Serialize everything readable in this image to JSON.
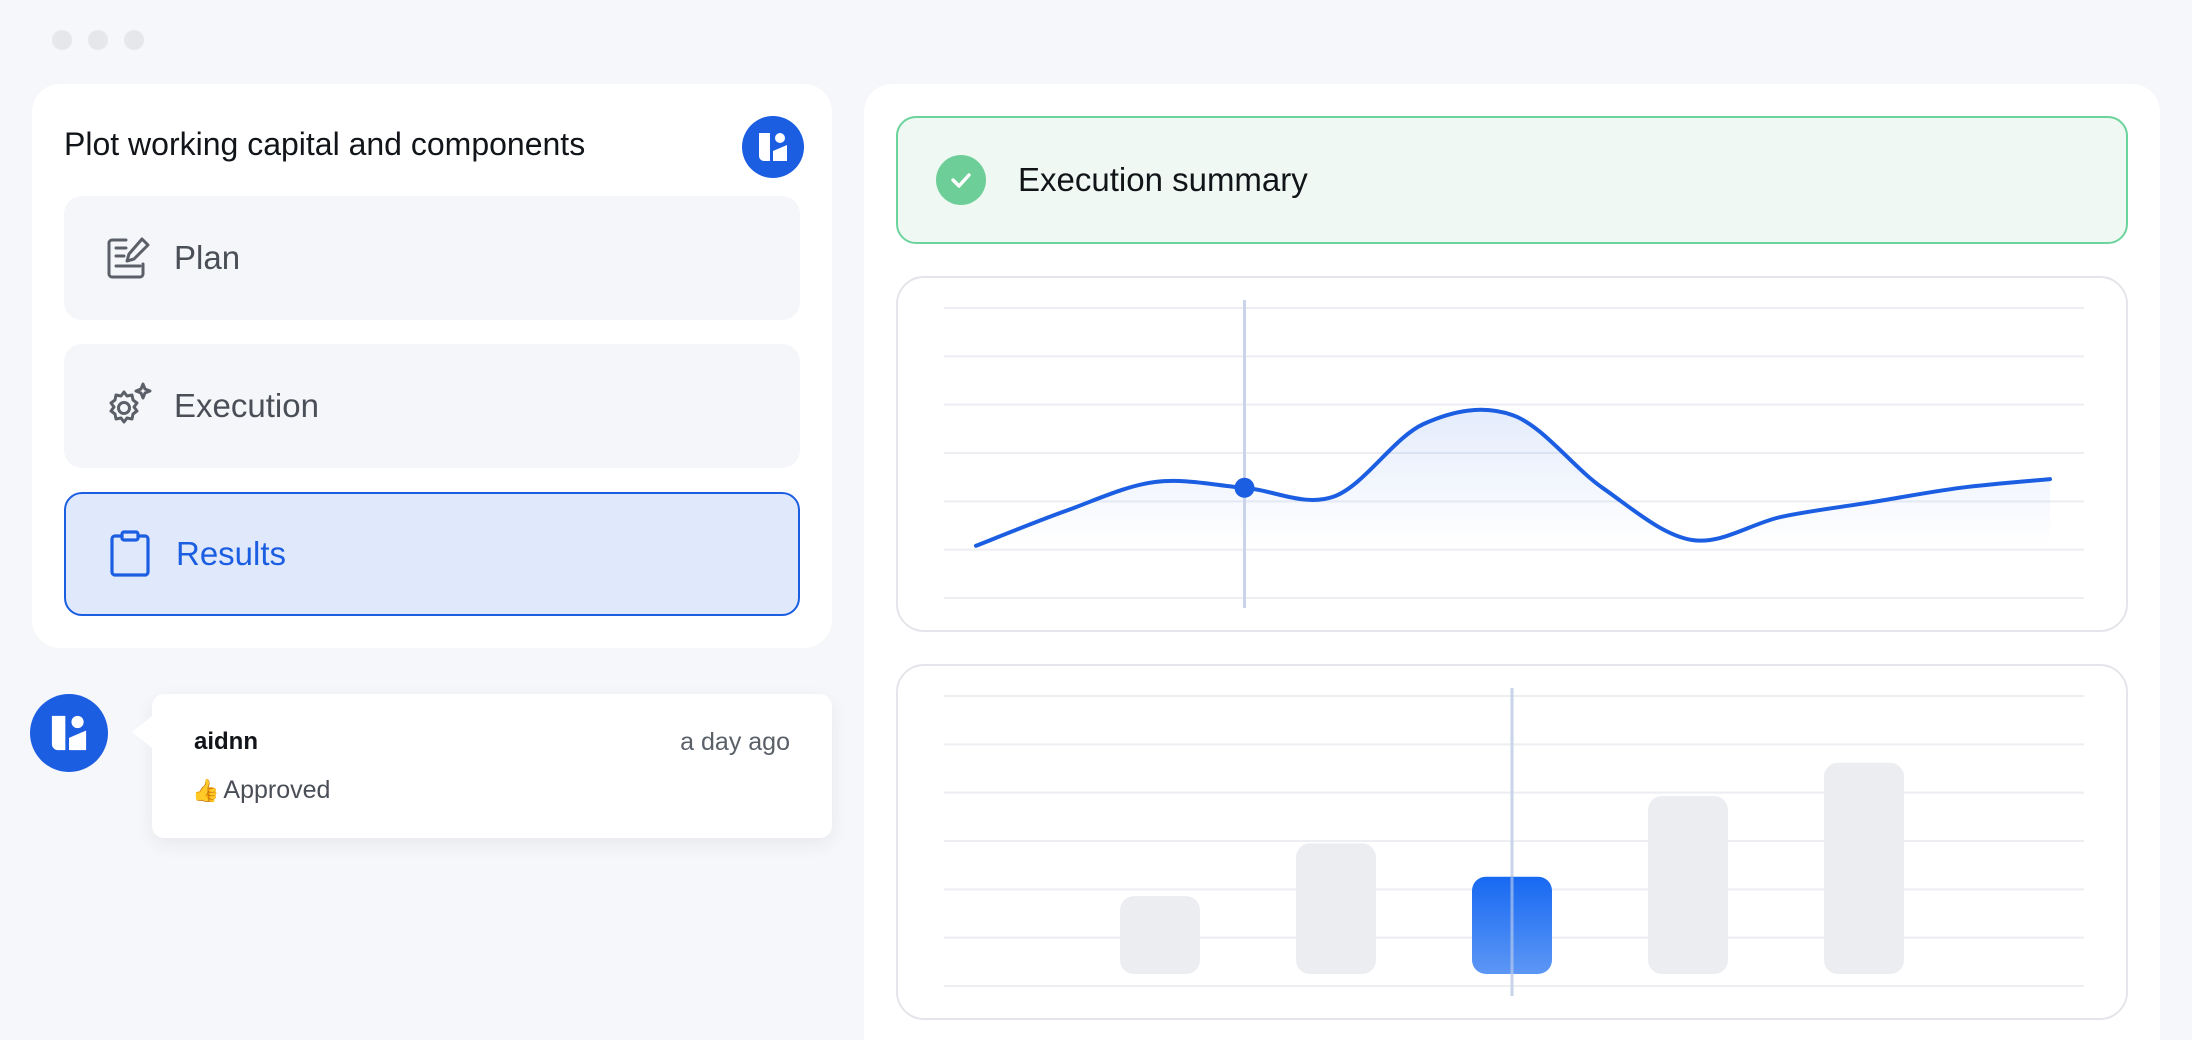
{
  "window": {
    "controls": [
      "close",
      "minimize",
      "maximize"
    ]
  },
  "task": {
    "title": "Plot working capital and components"
  },
  "steps": [
    {
      "label": "Plan",
      "icon": "edit-icon",
      "active": false
    },
    {
      "label": "Execution",
      "icon": "gear-sparkle-icon",
      "active": false
    },
    {
      "label": "Results",
      "icon": "clipboard-icon",
      "active": true
    }
  ],
  "comment": {
    "author": "aidnn",
    "time": "a day ago",
    "emoji": "👍",
    "text": "Approved"
  },
  "summary": {
    "label": "Execution summary",
    "icon": "check-circle-icon"
  },
  "colors": {
    "accent": "#1c5ee2",
    "success": "#6dcf97",
    "success_bg": "#eff8f2",
    "bar_inactive": "#ecedf1"
  },
  "chart_data": [
    {
      "type": "line",
      "x": [
        0,
        1,
        2,
        3,
        4,
        5,
        6,
        7,
        8,
        9,
        10,
        11,
        12
      ],
      "values": [
        18,
        30,
        40,
        38,
        35,
        60,
        63,
        38,
        20,
        28,
        33,
        38,
        41
      ],
      "highlight_index": 3,
      "ylim": [
        0,
        100
      ],
      "grid": true
    },
    {
      "type": "bar",
      "values": [
        28,
        47,
        35,
        64,
        76
      ],
      "highlight_index": 2,
      "ylim": [
        0,
        100
      ],
      "grid": true
    }
  ]
}
